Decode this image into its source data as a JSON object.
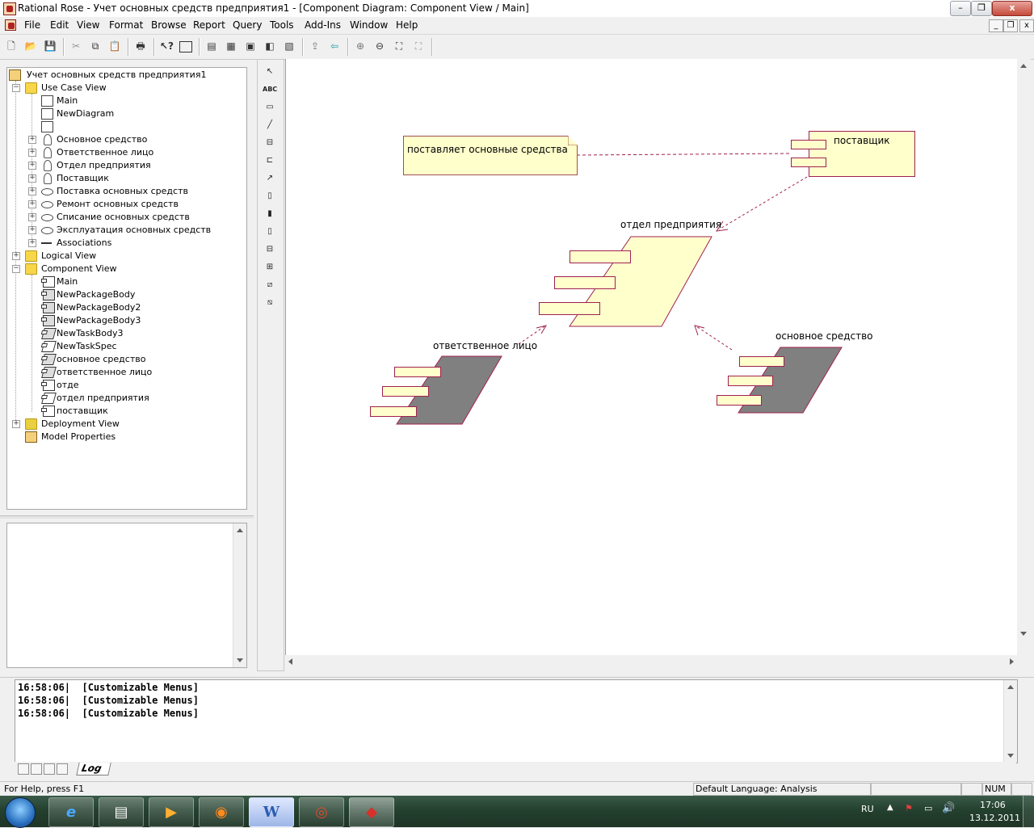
{
  "window": {
    "title": "Rational Rose - Учет основных средств предприятия1 - [Component Diagram: Component View / Main]",
    "minimize": "–",
    "maximize": "❐",
    "close": "x"
  },
  "menu": {
    "items": [
      "File",
      "Edit",
      "View",
      "Format",
      "Browse",
      "Report",
      "Query",
      "Tools",
      "Add-Ins",
      "Window",
      "Help"
    ],
    "mdi_minimize": "_",
    "mdi_restore": "❐",
    "mdi_close": "x"
  },
  "toolbar": {
    "icons": [
      "new-icon",
      "open-icon",
      "save-icon",
      "cut-icon",
      "copy-icon",
      "paste-icon",
      "print-icon",
      "context-help-icon",
      "view-doc-icon",
      "browse-class-icon",
      "browse-interaction-icon",
      "browse-component-icon",
      "browse-deployment-icon",
      "browse-parent-icon",
      "browse-previous-icon",
      "zoom-in-icon",
      "zoom-out-icon",
      "fit-window-icon",
      "undo-fit-icon"
    ]
  },
  "tree": {
    "root": "Учет основных средств предприятия1",
    "use_case_view": "Use Case View",
    "use_case_items": [
      "Main",
      "NewDiagram",
      "",
      "Основное средство",
      "Ответственное лицо",
      "Отдел предприятия",
      "Поставщик",
      "Поставка основных средств",
      "Ремонт основных средств",
      "Списание основных средств",
      "Эксплуатация основных средств",
      "Associations"
    ],
    "logical_view": "Logical View",
    "component_view": "Component View",
    "component_items": [
      "Main",
      "NewPackageBody",
      "NewPackageBody2",
      "NewPackageBody3",
      "NewTaskBody3",
      "NewTaskSpec",
      "основное средство",
      "ответственное лицо",
      "отде",
      "отдел предприятия",
      "поставщик"
    ],
    "deployment_view": "Deployment View",
    "model_properties": "Model Properties"
  },
  "diagram": {
    "note_text": "поставляет основные средства",
    "supplier": "поставщик",
    "department": "отдел предприятия",
    "responsible": "ответственное лицо",
    "asset": "основное средство"
  },
  "log": {
    "lines": [
      "16:58:06|  [Customizable Menus]",
      "16:58:06|  [Customizable Menus]",
      "16:58:06|  [Customizable Menus]"
    ],
    "tab": "Log"
  },
  "status": {
    "help": "For Help, press F1",
    "language": "Default Language: Analysis",
    "num": "NUM"
  },
  "taskbar": {
    "lang": "RU",
    "time": "17:06",
    "date": "13.12.2011",
    "word_label": "W"
  },
  "colors": {
    "component_fill": "#ffffcc",
    "component_border": "#a02050",
    "gray_component": "#808080"
  }
}
